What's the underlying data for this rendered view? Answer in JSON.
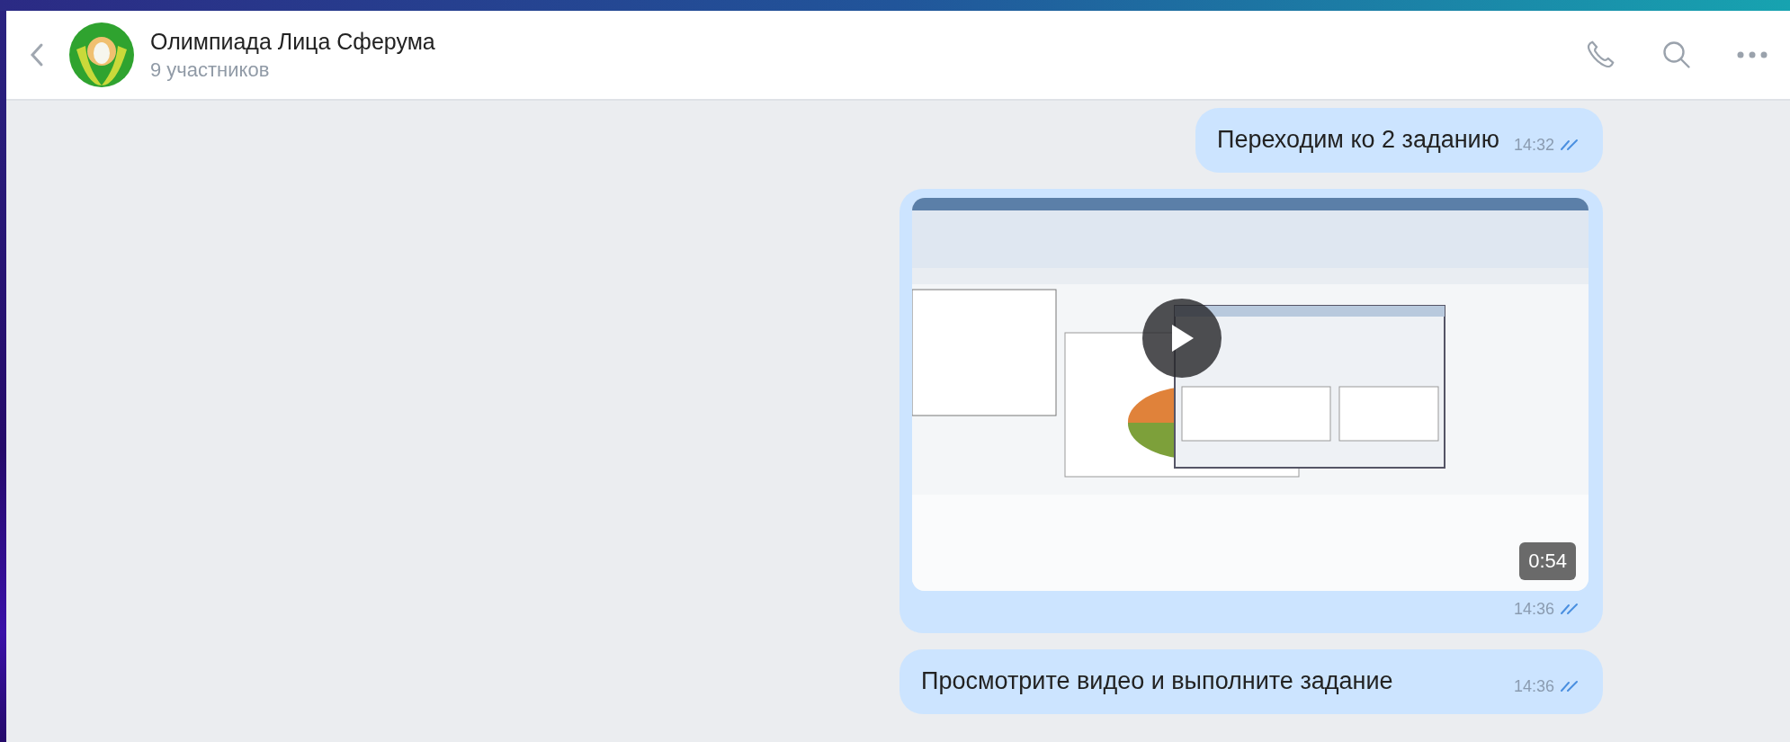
{
  "chat": {
    "title": "Олимпиада Лица Сферума",
    "subtitle": "9 участников"
  },
  "messages": [
    {
      "kind": "text",
      "text": "Переходим ко 2 заданию",
      "time": "14:32",
      "read": true
    },
    {
      "kind": "video",
      "duration": "0:54",
      "time": "14:36",
      "read": true
    },
    {
      "kind": "text",
      "text": "Просмотрите видео и выполните задание",
      "time": "14:36",
      "read": true
    }
  ]
}
